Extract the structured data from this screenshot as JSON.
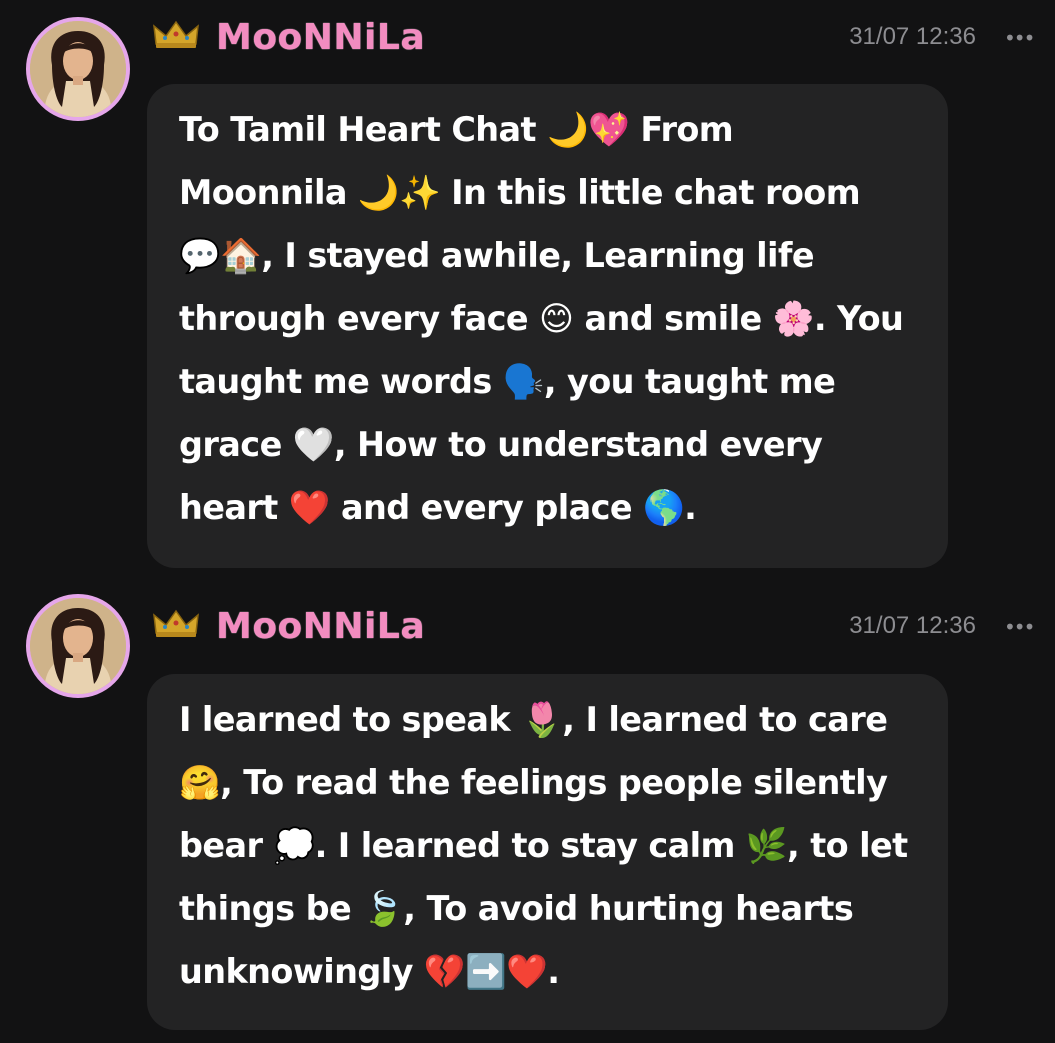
{
  "messages": [
    {
      "username": "MooNNiLa",
      "timestamp": "31/07 12:36",
      "more_label": "•••",
      "avatar_icon": "user-avatar",
      "badge_icon": "crown-icon",
      "text": "To Tamil Heart Chat 🌙💖 From\nMoonnila 🌙✨ In this little chat room\n💬🏠, I stayed awhile, Learning life\nthrough every face 😊 and smile 🌸. You\ntaught me words 🗣️, you taught me\ngrace 🤍, How to understand every\nheart ❤️ and every place 🌎."
    },
    {
      "username": "MooNNiLa",
      "timestamp": "31/07 12:36",
      "more_label": "•••",
      "avatar_icon": "user-avatar",
      "badge_icon": "crown-icon",
      "text": "I learned to speak 🌷, I learned to care\n🤗, To read the feelings people silently\nbear 💭. I learned to stay calm 🌿, to let\nthings be 🍃, To avoid hurting hearts\nunknowingly 💔➡️❤️."
    }
  ],
  "colors": {
    "background": "#121213",
    "bubble": "#232324",
    "username": "#f28cc0",
    "avatar_ring": "#e5a6ea",
    "timestamp": "#8d8d91",
    "text": "#ffffff"
  }
}
